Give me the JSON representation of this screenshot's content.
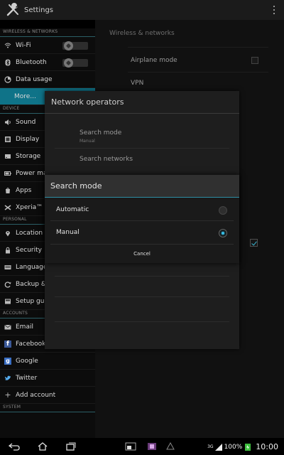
{
  "actionbar": {
    "title": "Settings"
  },
  "sidebar": {
    "sections": [
      {
        "label": "WIRELESS & NETWORKS"
      },
      {
        "label": "DEVICE"
      },
      {
        "label": "PERSONAL"
      },
      {
        "label": "ACCOUNTS"
      },
      {
        "label": "SYSTEM"
      }
    ],
    "items": [
      {
        "label": "Wi-Fi",
        "icon": "wifi-icon"
      },
      {
        "label": "Bluetooth",
        "icon": "bluetooth-icon"
      },
      {
        "label": "Data usage",
        "icon": "data-usage-icon"
      },
      {
        "label": "More...",
        "icon": ""
      },
      {
        "label": "Sound",
        "icon": "speaker-icon"
      },
      {
        "label": "Display",
        "icon": "display-icon"
      },
      {
        "label": "Storage",
        "icon": "storage-icon"
      },
      {
        "label": "Power man",
        "icon": "battery-icon"
      },
      {
        "label": "Apps",
        "icon": "apps-icon"
      },
      {
        "label": "Xperia™",
        "icon": "xperia-icon"
      },
      {
        "label": "Location se",
        "icon": "location-icon"
      },
      {
        "label": "Security",
        "icon": "lock-icon"
      },
      {
        "label": "Language &",
        "icon": "language-icon"
      },
      {
        "label": "Backup & r",
        "icon": "backup-icon"
      },
      {
        "label": "Setup guid",
        "icon": "setup-guide-icon"
      },
      {
        "label": "Email",
        "icon": "email-icon"
      },
      {
        "label": "Facebook",
        "icon": "facebook-icon"
      },
      {
        "label": "Google",
        "icon": "google-icon"
      },
      {
        "label": "Twitter",
        "icon": "twitter-icon"
      },
      {
        "label": "Add account",
        "icon": "plus-icon"
      }
    ]
  },
  "rightpane": {
    "header": "Wireless & networks",
    "items": [
      {
        "label": "Airplane mode"
      },
      {
        "label": "VPN"
      }
    ]
  },
  "operators_dialog": {
    "title": "Network operators",
    "search_mode_label": "Search mode",
    "search_mode_value": "Manual",
    "search_networks_label": "Search networks"
  },
  "search_dialog": {
    "title": "Search mode",
    "options": [
      {
        "label": "Automatic",
        "selected": false
      },
      {
        "label": "Manual",
        "selected": true
      }
    ],
    "cancel_label": "Cancel"
  },
  "statusbar": {
    "network": "3G",
    "battery": "100%",
    "time": "10:00"
  },
  "colors": {
    "accent": "#0f7388",
    "radio_on": "#38c0e8",
    "background": "#111111"
  }
}
